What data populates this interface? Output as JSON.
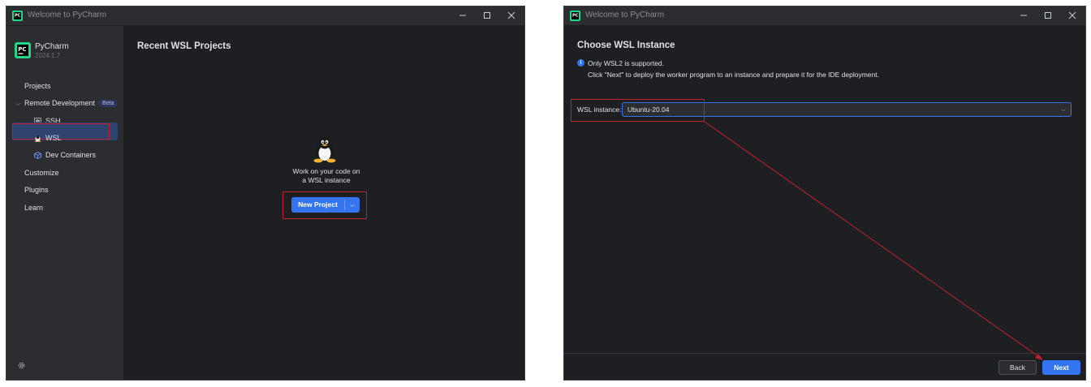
{
  "colors": {
    "accent": "#3574f0",
    "highlight": "#c0202e",
    "bg": "#1e1f22",
    "sidebar": "#2b2d30"
  },
  "left_window": {
    "titlebar": {
      "title": "Welcome to PyCharm"
    },
    "sidebar": {
      "app_name": "PyCharm",
      "app_version": "2024.1.7",
      "items": {
        "projects": "Projects",
        "remote_development": "Remote Development",
        "beta_badge": "Beta",
        "ssh": "SSH",
        "wsl": "WSL",
        "dev_containers": "Dev Containers",
        "customize": "Customize",
        "plugins": "Plugins",
        "learn": "Learn"
      }
    },
    "main": {
      "title": "Recent WSL Projects",
      "hint_line1": "Work on your code on",
      "hint_line2": "a WSL instance",
      "new_project_button": "New Project"
    }
  },
  "right_window": {
    "titlebar": {
      "title": "Welcome to PyCharm"
    },
    "title": "Choose WSL Instance",
    "info_line1": "Only WSL2 is supported.",
    "info_line2": "Click \"Next\" to deploy the worker program to an instance and prepare it for the IDE deployment.",
    "wsl_instance_label": "WSL instance:",
    "wsl_instance_value": "Ubuntu-20.04",
    "back_button": "Back",
    "next_button": "Next"
  }
}
